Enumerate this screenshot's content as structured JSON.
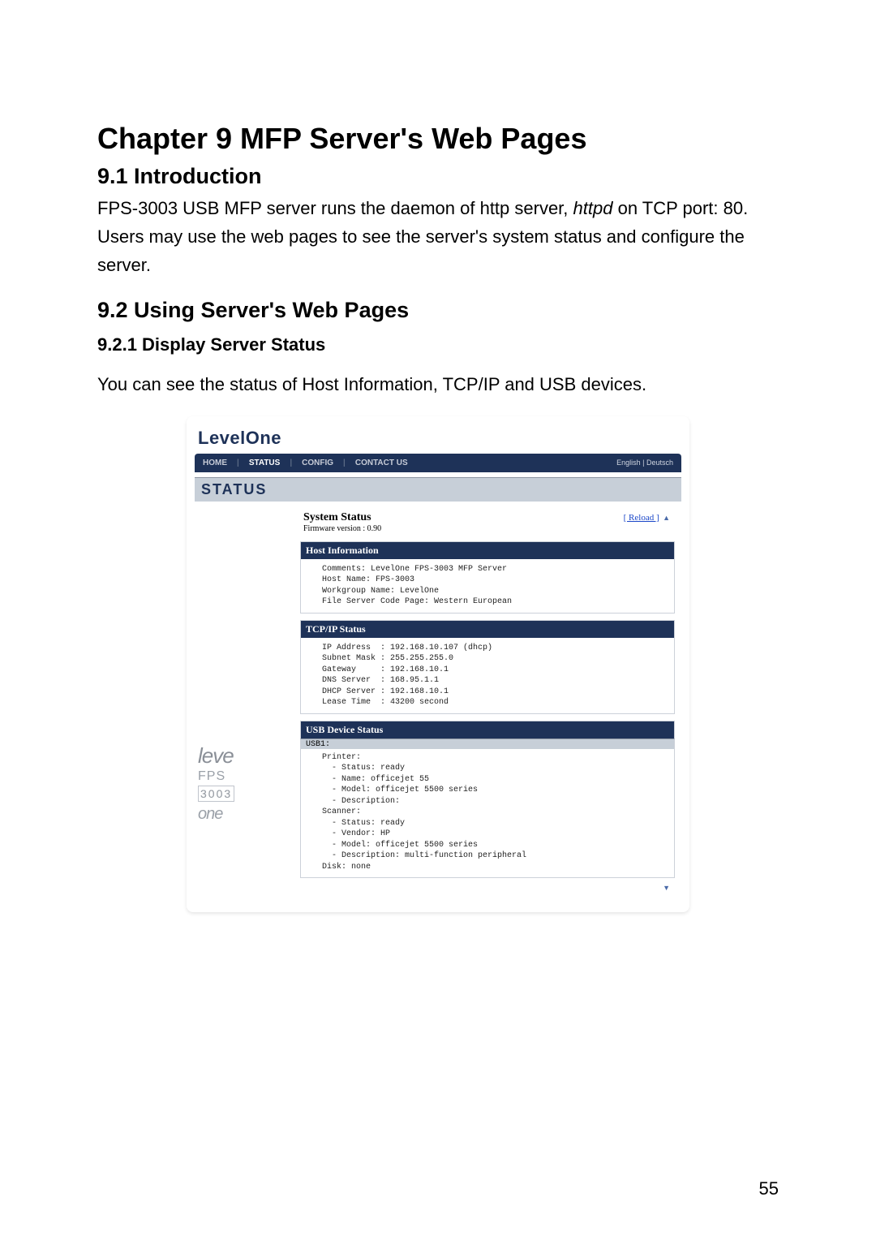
{
  "doc": {
    "chapter_title": "Chapter 9      MFP Server's Web Pages",
    "h2_1": "9.1    Introduction",
    "p1": "FPS-3003 USB MFP server runs the daemon of http server, ",
    "p1_em": "httpd",
    "p1_cont": " on TCP port: 80.   Users may use the web pages to see the server's system status and configure the server.",
    "h2_2": "9.2    Using Server's Web Pages",
    "h3_1": "9.2.1   Display Server Status",
    "p2": "You can see the status of Host Information, TCP/IP and USB devices.",
    "page_number": "55"
  },
  "ui": {
    "brand": "LevelOne",
    "nav": {
      "home": "HOME",
      "status": "STATUS",
      "config": "CONFIG",
      "contact": "CONTACT US",
      "lang": "English | Deutsch"
    },
    "status_label": "STATUS",
    "system_status": {
      "title": "System Status",
      "fw": "Firmware version : 0.90",
      "reload": "[ Reload ]"
    },
    "host": {
      "title": "Host Information",
      "body": "   Comments: LevelOne FPS-3003 MFP Server\n   Host Name: FPS-3003\n   Workgroup Name: LevelOne\n   File Server Code Page: Western European"
    },
    "tcpip": {
      "title": "TCP/IP Status",
      "body": "   IP Address  : 192.168.10.107 (dhcp)\n   Subnet Mask : 255.255.255.0\n   Gateway     : 192.168.10.1\n   DNS Server  : 168.95.1.1\n   DHCP Server : 192.168.10.1\n   Lease Time  : 43200 second"
    },
    "usb": {
      "title": "USB Device Status",
      "sub": "USB1:",
      "body": "   Printer:\n     - Status: ready\n     - Name: officejet 55\n     - Model: officejet 5500 series\n     - Description:\n   Scanner:\n     - Status: ready\n     - Vendor: HP\n     - Model: officejet 5500 series\n     - Description: multi-function peripheral\n   Disk: none"
    },
    "side": {
      "l1": "leve",
      "l2": "FPS",
      "l3": "3003",
      "l4": "one"
    }
  }
}
